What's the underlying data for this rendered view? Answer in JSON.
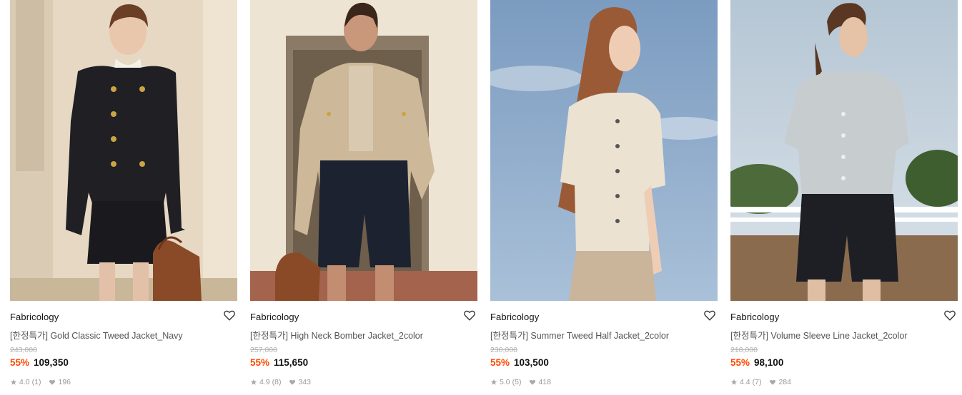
{
  "products": [
    {
      "brand": "Fabricology",
      "name": "[한정특가] Gold Classic Tweed Jacket_Navy",
      "original_price": "243,000",
      "discount": "55%",
      "price": "109,350",
      "rating": "4.0",
      "review_count": "(1)",
      "likes": "196",
      "image_alt": "Model in navy tweed jacket and skirt with brown bag"
    },
    {
      "brand": "Fabricology",
      "name": "[한정특가] High Neck Bomber Jacket_2color",
      "original_price": "257,000",
      "discount": "55%",
      "price": "115,650",
      "rating": "4.9",
      "review_count": "(8)",
      "likes": "343",
      "image_alt": "Model in beige bomber jacket and navy shorts"
    },
    {
      "brand": "Fabricology",
      "name": "[한정특가] Summer Tweed Half Jacket_2color",
      "original_price": "230,000",
      "discount": "55%",
      "price": "103,500",
      "rating": "5.0",
      "review_count": "(5)",
      "likes": "418",
      "image_alt": "Model in ivory half-sleeve tweed jacket against sky"
    },
    {
      "brand": "Fabricology",
      "name": "[한정특가] Volume Sleeve Line Jacket_2color",
      "original_price": "218,000",
      "discount": "55%",
      "price": "98,100",
      "rating": "4.4",
      "review_count": "(7)",
      "likes": "284",
      "image_alt": "Model in grey volume sleeve jacket outdoors"
    }
  ],
  "colors": {
    "discount": "#ff4800",
    "strike": "#b0b0b0",
    "meta": "#999999"
  }
}
